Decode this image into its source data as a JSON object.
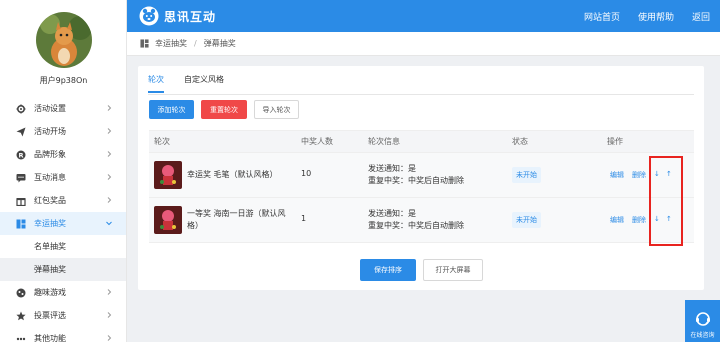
{
  "user": {
    "name": "用户9p38On"
  },
  "sidebar": {
    "items": [
      {
        "label": "活动设置",
        "icon": "gear-icon"
      },
      {
        "label": "活动开场",
        "icon": "send-icon"
      },
      {
        "label": "品牌形象",
        "icon": "brand-r-icon"
      },
      {
        "label": "互动消息",
        "icon": "chat-icon"
      },
      {
        "label": "红包奖品",
        "icon": "gift-icon"
      },
      {
        "label": "幸运抽奖",
        "icon": "lottery-icon"
      },
      {
        "label": "趣味游戏",
        "icon": "game-icon"
      },
      {
        "label": "投票评选",
        "icon": "star-icon"
      },
      {
        "label": "其他功能",
        "icon": "more-icon"
      }
    ],
    "subitems": [
      {
        "label": "名单抽奖"
      },
      {
        "label": "弹幕抽奖"
      }
    ]
  },
  "topbar": {
    "brand": "思讯互动",
    "nav": [
      "网站首页",
      "使用帮助",
      "返回"
    ]
  },
  "breadcrumb": {
    "parent": "幸运抽奖",
    "separator": "/",
    "current": "弹幕抽奖"
  },
  "tabs": [
    "轮次",
    "自定义风格"
  ],
  "toolbar": {
    "add": "添加轮次",
    "reset": "重置轮次",
    "import": "导入轮次"
  },
  "table": {
    "headers": [
      "轮次",
      "中奖人数",
      "轮次信息",
      "状态",
      "操作"
    ],
    "rows": [
      {
        "name": "幸运奖 毛笔（默认风格）",
        "winners": "10",
        "info1": "发送通知：是",
        "info2": "重复中奖：中奖后自动删除",
        "status": "未开始",
        "edit": "编辑",
        "delete": "删除",
        "down": "↓",
        "up": "↑"
      },
      {
        "name": "一等奖 海南一日游（默认风格）",
        "winners": "1",
        "info1": "发送通知：是",
        "info2": "重复中奖：中奖后自动删除",
        "status": "未开始",
        "edit": "编辑",
        "delete": "删除",
        "down": "↓",
        "up": "↑"
      }
    ]
  },
  "footer_buttons": {
    "save": "保存排序",
    "open": "打开大屏幕"
  },
  "chat_widget": {
    "label": "在线咨询"
  },
  "colors": {
    "primary": "#2b8be6",
    "danger": "#f04848",
    "highlight": "#e8231f"
  }
}
